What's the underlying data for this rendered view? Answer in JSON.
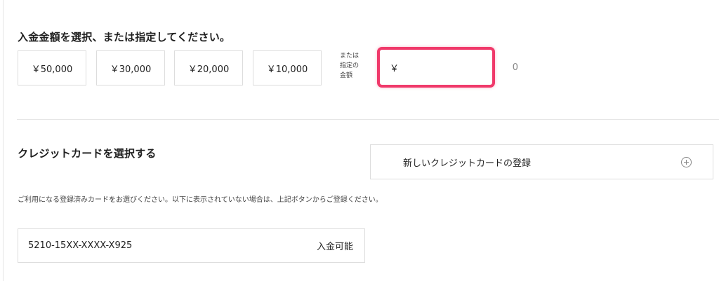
{
  "deposit": {
    "title": "入金金額を選択、または指定してください。",
    "amounts": [
      "￥50,000",
      "￥30,000",
      "￥20,000",
      "￥10,000"
    ],
    "or_label": [
      "または",
      "指定の",
      "金額"
    ],
    "custom": {
      "currency": "￥",
      "value": "0"
    }
  },
  "card": {
    "title": "クレジットカードを選択する",
    "new_card_label": "新しいクレジットカードの登録",
    "new_card_icon": "plus-circle-icon",
    "note": "ご利用になる登録済みカードをお選びください。以下に表示されていない場合は、上記ボタンからご登録ください。",
    "registered": [
      {
        "number": "5210-15XX-XXXX-X925",
        "status": "入金可能"
      }
    ]
  },
  "colors": {
    "highlight": "#f0396a",
    "border": "#dddddd"
  }
}
